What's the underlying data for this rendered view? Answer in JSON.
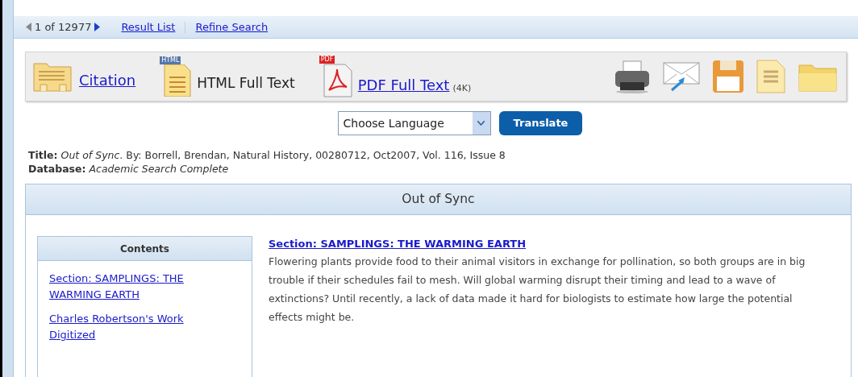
{
  "nav": {
    "position": "1 of 12977",
    "links": [
      "Result List",
      "Refine Search"
    ]
  },
  "toolbar": {
    "formats": [
      {
        "kind": "citation",
        "label": "Citation",
        "link": true
      },
      {
        "kind": "html",
        "label": "HTML Full Text",
        "link": false,
        "badge": "HTML"
      },
      {
        "kind": "pdf",
        "label": "PDF Full Text",
        "link": true,
        "size": "(4K)",
        "badge": "PDF"
      }
    ]
  },
  "translate": {
    "dropdown": "Choose Language",
    "button": "Translate"
  },
  "record": [
    {
      "label": "Title:",
      "value": "*Out of Sync*. By: Borrell, Brendan, Natural History, 00280712, Oct2007, Vol. 116, Issue 8"
    },
    {
      "label": "Database:",
      "value": "*Academic Search Complete*"
    }
  ],
  "article": {
    "heading": "Out of Sync",
    "contents": {
      "title": "Contents",
      "items": [
        "Section: SAMPLINGS: THE WARMING EARTH",
        "Charles Robertson's Work Digitized"
      ]
    },
    "section_link": "Section: SAMPLINGS: THE WARMING EARTH",
    "paragraph": "Flowering plants provide food to their animal visitors in exchange for pollination, so both groups are in big trouble if their schedules fail to mesh. Will global warming disrupt their timing and lead to a wave of extinctions? Until recently, a lack of data made it hard for biologists to estimate how large the potential effects might be."
  }
}
